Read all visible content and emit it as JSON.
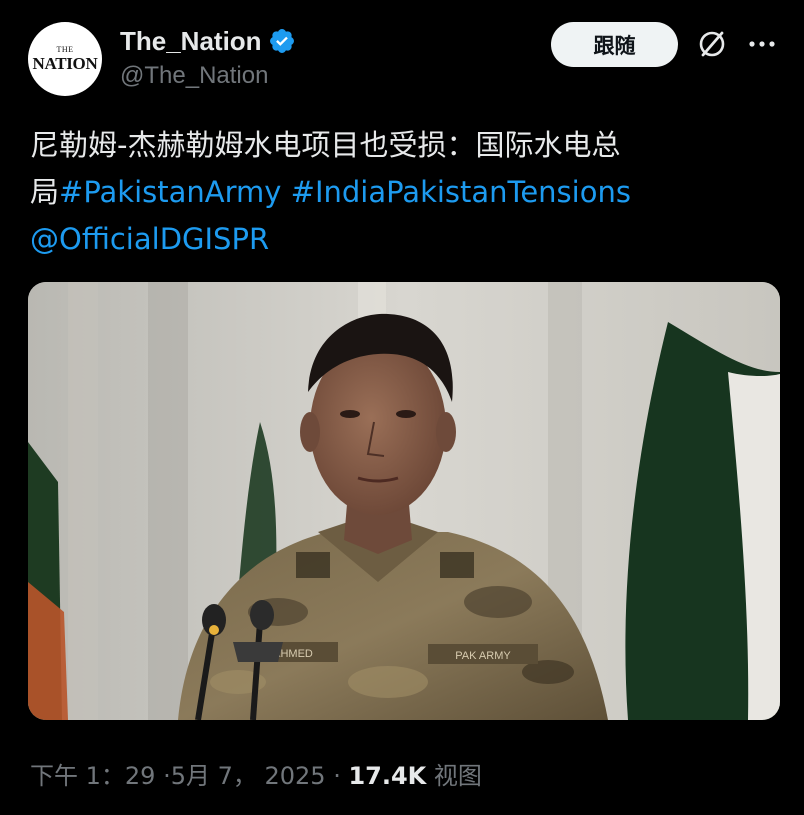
{
  "account": {
    "avatar_top": "THE",
    "avatar_main": "NATION",
    "display_name": "The_Nation",
    "handle": "@The_Nation",
    "verified_color": "#1d9bf0"
  },
  "actions": {
    "follow_label": "跟随",
    "grok_icon": "grok-icon",
    "more_icon": "more-dots-icon"
  },
  "tweet": {
    "line1": "尼勒姆-杰赫勒姆水电项目也受损：国际水电总",
    "line2_prefix": "局",
    "hashtag1": "#PakistanArmy",
    "hashtag2": "#IndiaPakistanTensions",
    "mention": "@OfficialDGISPR"
  },
  "media": {
    "type": "video-still",
    "uniform_name": "AHMED",
    "uniform_branch": "PAK ARMY"
  },
  "meta": {
    "time": "下午 1：29",
    "date": "5月 7， 2025",
    "separator1": " ·",
    "separator2": " · ",
    "views_count": "17.4K",
    "views_label": " 视图"
  },
  "colors": {
    "background": "#000000",
    "text": "#e7e9ea",
    "secondary": "#71767b",
    "link": "#1d9bf0"
  }
}
